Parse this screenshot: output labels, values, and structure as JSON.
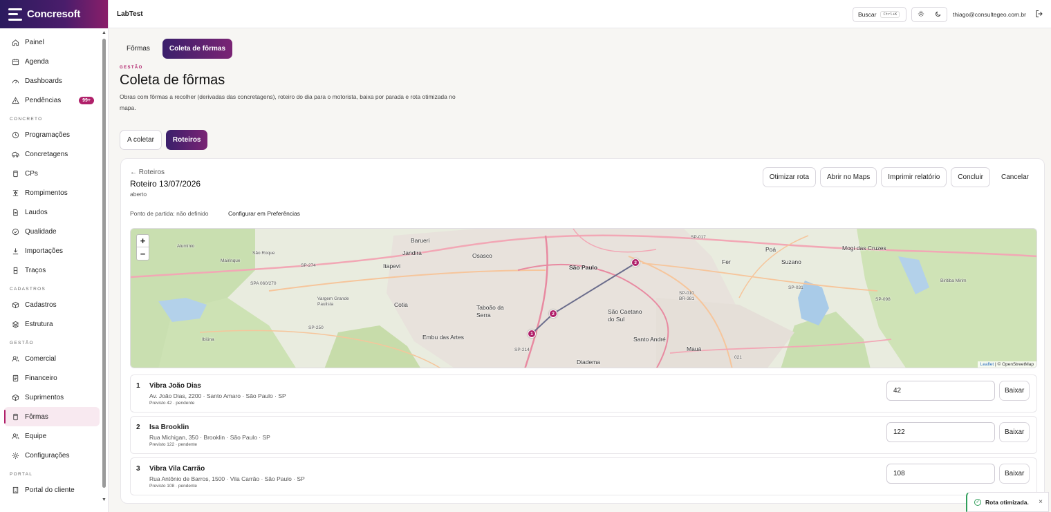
{
  "brand": {
    "name": "Concresoft"
  },
  "sidebar": {
    "items_a": [
      {
        "label": "Painel",
        "icon": "home-icon"
      },
      {
        "label": "Agenda",
        "icon": "calendar-icon"
      },
      {
        "label": "Dashboards",
        "icon": "gauge-icon"
      },
      {
        "label": "Pendências",
        "icon": "alert-triangle-icon",
        "badge": "99+"
      }
    ],
    "section_concreto": "CONCRETO",
    "items_concreto": [
      {
        "label": "Programações",
        "icon": "clock-icon"
      },
      {
        "label": "Concretagens",
        "icon": "truck-icon"
      },
      {
        "label": "CPs",
        "icon": "cylinder-icon"
      },
      {
        "label": "Rompimentos",
        "icon": "press-icon"
      },
      {
        "label": "Laudos",
        "icon": "document-icon"
      },
      {
        "label": "Qualidade",
        "icon": "check-circle-icon"
      },
      {
        "label": "Importações",
        "icon": "download-icon"
      },
      {
        "label": "Traços",
        "icon": "flask-icon"
      }
    ],
    "section_cadastros": "CADASTROS",
    "items_cadastros": [
      {
        "label": "Cadastros",
        "icon": "box-icon"
      },
      {
        "label": "Estrutura",
        "icon": "layers-icon"
      }
    ],
    "section_gestao": "GESTÃO",
    "items_gestao": [
      {
        "label": "Comercial",
        "icon": "users-icon"
      },
      {
        "label": "Financeiro",
        "icon": "receipt-icon"
      },
      {
        "label": "Suprimentos",
        "icon": "package-icon"
      },
      {
        "label": "Fôrmas",
        "icon": "cylinder-icon",
        "active": true
      },
      {
        "label": "Equipe",
        "icon": "users-icon"
      },
      {
        "label": "Configurações",
        "icon": "gear-icon"
      }
    ],
    "section_portal": "PORTAL",
    "items_portal": [
      {
        "label": "Portal do cliente",
        "icon": "building-icon"
      }
    ]
  },
  "topbar": {
    "app_title": "LabTest",
    "search_label": "Buscar",
    "search_shortcut": "Ctrl+K",
    "user_email": "thiago@consultegeo.com.br"
  },
  "main": {
    "tabs": [
      {
        "label": "Fôrmas"
      },
      {
        "label": "Coleta de fôrmas",
        "active": true
      }
    ],
    "eyebrow": "GESTÃO",
    "title": "Coleta de fôrmas",
    "description": "Obras com fôrmas a recolher (derivadas das concretagens), roteiro do dia para o motorista, baixa por parada e rota otimizada no mapa.",
    "subtabs": [
      {
        "label": "A coletar"
      },
      {
        "label": "Roteiros",
        "active": true
      }
    ]
  },
  "card": {
    "back": "← Roteiros",
    "title": "Roteiro 13/07/2026",
    "status": "aberto",
    "start_point": "Ponto de partida: não definido",
    "config_link": "Configurar em Preferências",
    "actions": {
      "optimize": "Otimizar rota",
      "maps": "Abrir no Maps",
      "print": "Imprimir relatório",
      "conclude": "Concluir",
      "cancel": "Cancelar"
    }
  },
  "map": {
    "zoom_in": "+",
    "zoom_out": "−",
    "attribution_leaflet": "Leaflet",
    "attribution_osm": "| © OpenStreetMap",
    "places": {
      "barueri": "Barueri",
      "jandira": "Jandira",
      "osasco": "Osasco",
      "itapevi": "Itapevi",
      "sao_paulo": "São Paulo",
      "taboao": "Taboão da\nSerra",
      "cotia": "Cotia",
      "embu": "Embu das Artes",
      "diadema": "Diadema",
      "sao_caetano": "São Caetano\ndo Sul",
      "santo_andre": "Santo André",
      "maua": "Mauá",
      "ferraz": "Fer",
      "poa": "Poá",
      "suzano": "Suzano",
      "mogi": "Mogi das Cruzes",
      "aluminio": "Alumínio",
      "mairinque": "Mairinque",
      "sao_roque": "São Roque",
      "vargem": "Vargem Grande\nPaulista",
      "ibiuna": "Ibiúna",
      "biritiba": "Biritiba Mirim",
      "sp274": "SP-274",
      "sp270": "SPA 060/270",
      "sp250": "SP-250",
      "sp214": "SP-214",
      "sp017": "SP-017",
      "sp010": "SP-010\nBR-381",
      "sp031": "SP-031",
      "sp098": "SP-098",
      "r021": "021"
    },
    "markers": [
      "1",
      "2",
      "3"
    ]
  },
  "stops": [
    {
      "num": "1",
      "name": "Vibra João Dias",
      "address": "Av. João Dias, 2200 · Santo Amaro · São Paulo · SP",
      "meta": "Previsto 42 · pendente",
      "qty": "42",
      "action": "Baixar"
    },
    {
      "num": "2",
      "name": "Isa Brooklin",
      "address": "Rua Michigan, 350 · Brooklin · São Paulo · SP",
      "meta": "Previsto 122 · pendente",
      "qty": "122",
      "action": "Baixar"
    },
    {
      "num": "3",
      "name": "Vibra Vila Carrão",
      "address": "Rua Antônio de Barros, 1500 · Vila Carrão · São Paulo · SP",
      "meta": "Previsto 108 · pendente",
      "qty": "108",
      "action": "Baixar"
    }
  ],
  "toast": {
    "message": "Rota otimizada.",
    "close": "×"
  },
  "colors": {
    "accent": "#b0206a",
    "brand_dark": "#2b1b5e",
    "success": "#2f9e5a"
  }
}
